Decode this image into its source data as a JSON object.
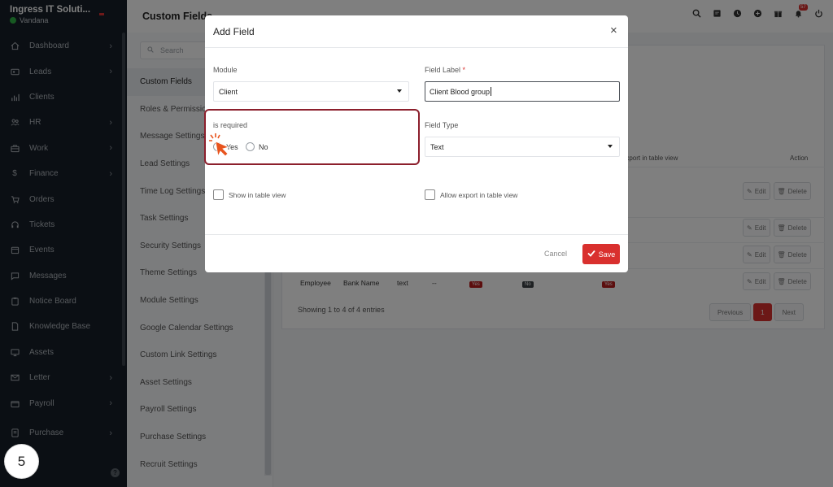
{
  "sidebar": {
    "company": "Ingress IT Soluti...",
    "user": "Vandana",
    "items": [
      {
        "label": "Dashboard",
        "icon": "house-icon",
        "chevron": true
      },
      {
        "label": "Leads",
        "icon": "id-card-icon",
        "chevron": true
      },
      {
        "label": "Clients",
        "icon": "bar-chart-icon",
        "chevron": false
      },
      {
        "label": "HR",
        "icon": "users-icon",
        "chevron": true
      },
      {
        "label": "Work",
        "icon": "briefcase-icon",
        "chevron": true
      },
      {
        "label": "Finance",
        "icon": "dollar-icon",
        "chevron": true
      },
      {
        "label": "Orders",
        "icon": "cart-icon",
        "chevron": false
      },
      {
        "label": "Tickets",
        "icon": "headset-icon",
        "chevron": false
      },
      {
        "label": "Events",
        "icon": "calendar-icon",
        "chevron": false
      },
      {
        "label": "Messages",
        "icon": "chat-icon",
        "chevron": false
      },
      {
        "label": "Notice Board",
        "icon": "clipboard-icon",
        "chevron": false
      },
      {
        "label": "Knowledge Base",
        "icon": "document-icon",
        "chevron": false
      },
      {
        "label": "Assets",
        "icon": "monitor-icon",
        "chevron": false
      },
      {
        "label": "Letter",
        "icon": "envelope-icon",
        "chevron": true
      },
      {
        "label": "Payroll",
        "icon": "wallet-icon",
        "chevron": true
      },
      {
        "label": "Purchase",
        "icon": "receipt-icon",
        "chevron": true
      }
    ],
    "step_number": "5"
  },
  "topbar": {
    "title": "Custom Fields",
    "notification_count": "57"
  },
  "settings_menu": {
    "search_placeholder": "Search",
    "items": [
      "Custom Fields",
      "Roles & Permissions",
      "Message Settings",
      "Lead Settings",
      "Time Log Settings",
      "Task Settings",
      "Security Settings",
      "Theme Settings",
      "Module Settings",
      "Google Calendar Settings",
      "Custom Link Settings",
      "Asset Settings",
      "Payroll Settings",
      "Purchase Settings",
      "Recruit Settings"
    ]
  },
  "table": {
    "export_header": "Export in table view",
    "action_header": "Action",
    "edit_label": "Edit",
    "delete_label": "Delete",
    "last_row": {
      "module": "Employee",
      "label": "Bank Name",
      "type": "text",
      "values": "--",
      "required": "Yes",
      "show": "No",
      "export": "Yes"
    },
    "entries_info": "Showing 1 to 4 of 4 entries",
    "prev_label": "Previous",
    "current_page": "1",
    "next_label": "Next"
  },
  "modal": {
    "title": "Add Field",
    "close_symbol": "×",
    "module_label": "Module",
    "module_value": "Client",
    "field_label_label": "Field Label",
    "field_label_required": "*",
    "field_label_value": "Client Blood group",
    "required_label": "is required",
    "yes_label": "Yes",
    "no_label": "No",
    "field_type_label": "Field Type",
    "field_type_value": "Text",
    "show_in_table_label": "Show in table view",
    "allow_export_label": "Allow export in table view",
    "cancel_label": "Cancel",
    "save_label": "Save"
  },
  "colors": {
    "sidebar_bg": "#171f29",
    "accent_red": "#d9302e",
    "highlight_border": "#8c1f2c",
    "click_marker": "#e8541e"
  }
}
